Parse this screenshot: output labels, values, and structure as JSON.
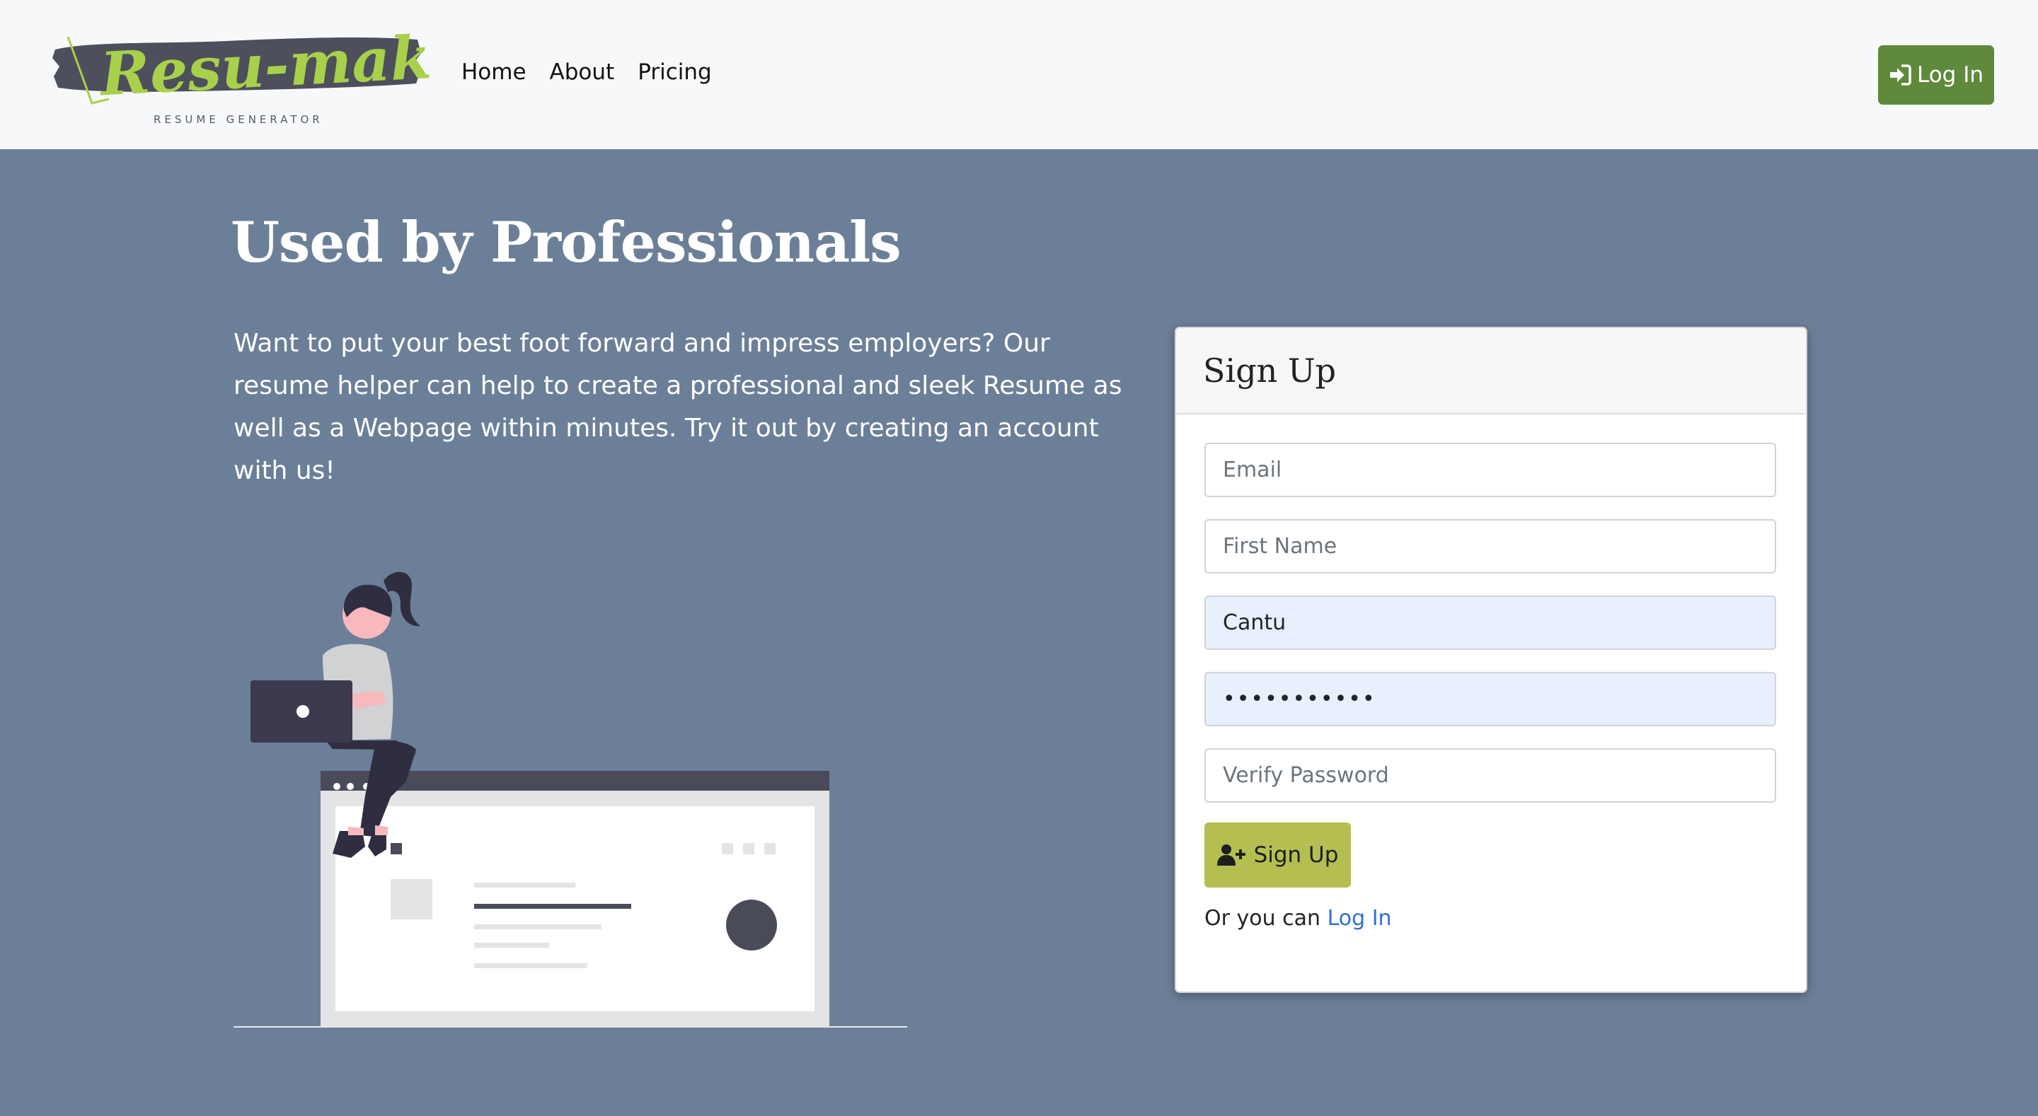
{
  "brand": {
    "logo_text": "Resu-make",
    "logo_subtext": "RESUME GENERATOR",
    "accent_color": "#a8d04a",
    "brush_color": "#4d4f5c"
  },
  "nav": {
    "items": [
      {
        "label": "Home"
      },
      {
        "label": "About"
      },
      {
        "label": "Pricing"
      }
    ],
    "login_label": "Log In",
    "login_icon": "sign-in-icon",
    "login_color": "#5f8a3c"
  },
  "hero": {
    "title": "Used by Professionals",
    "description": "Want to put your best foot forward and impress employers? Our resume helper can help to create a professional and sleek Resume as well as a Webpage within minutes. Try it out by creating an account with us!",
    "background_color": "#6c7f98"
  },
  "signup": {
    "title": "Sign Up",
    "email_placeholder": "Email",
    "first_name_placeholder": "First Name",
    "last_name_value": "Cantu",
    "password_value": "•••••••••••",
    "verify_password_placeholder": "Verify Password",
    "button_label": "Sign Up",
    "button_icon": "user-plus-icon",
    "button_color": "#b5bf51",
    "alt_prefix": "Or you can",
    "alt_link": "Log In",
    "link_color": "#2f6fd6"
  }
}
